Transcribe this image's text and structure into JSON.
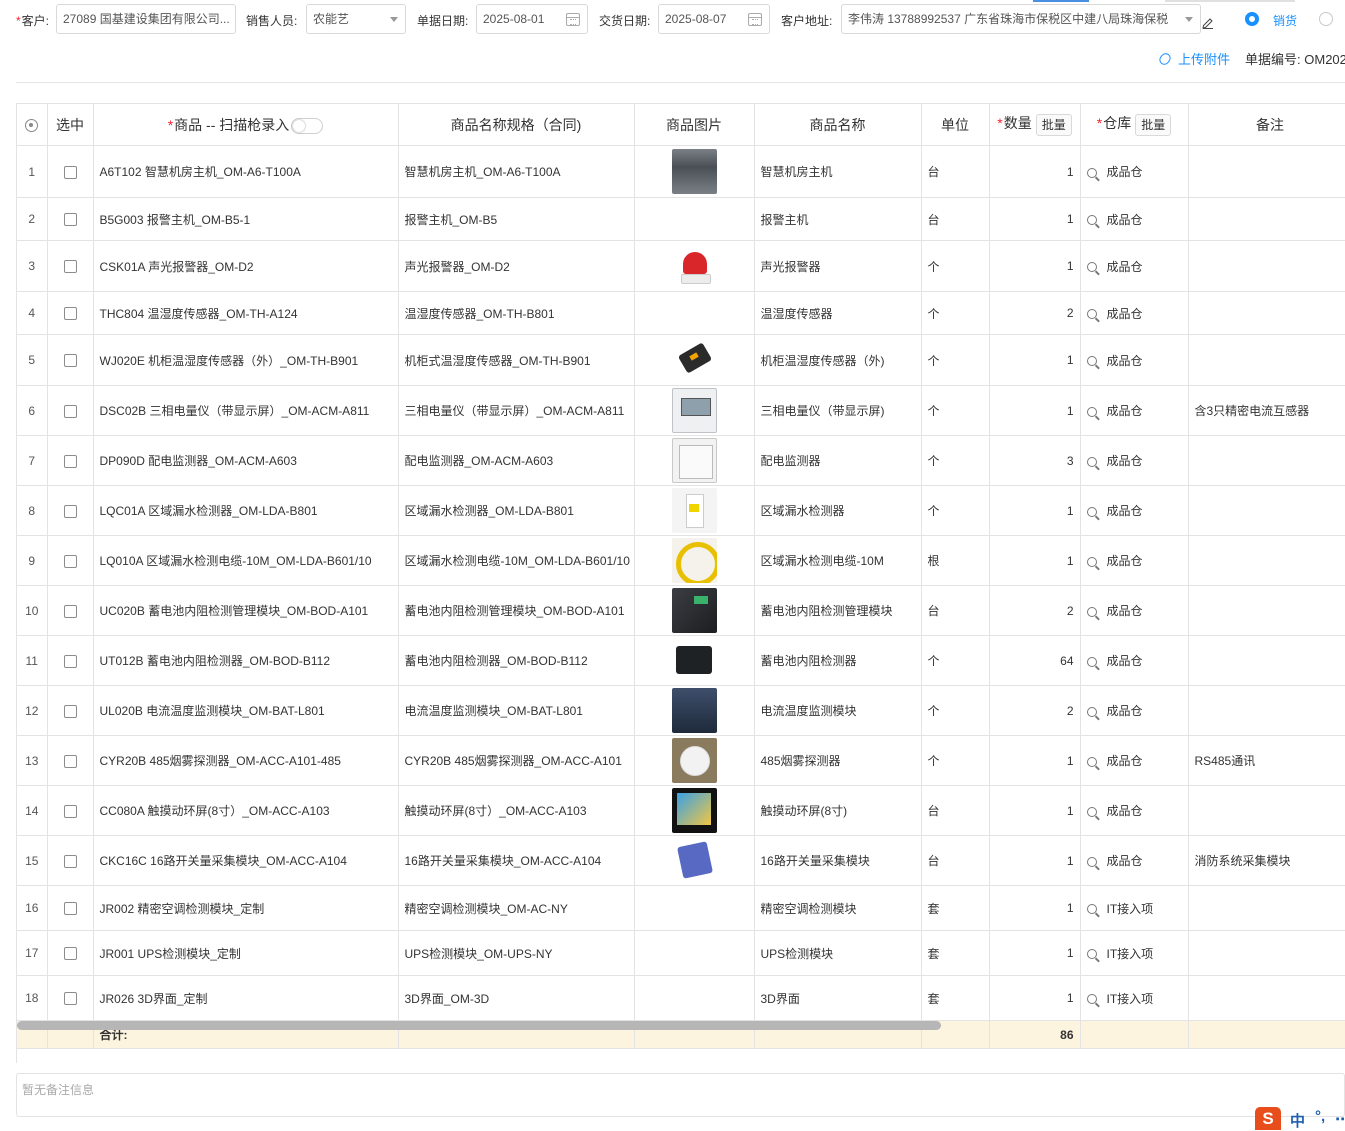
{
  "form": {
    "customer_label": "客户:",
    "customer_value": "27089 国基建设集团有限公司...",
    "sales_label": "销售人员:",
    "sales_value": "农能艺",
    "order_date_label": "单据日期:",
    "order_date_value": "2025-08-01",
    "delivery_date_label": "交货日期:",
    "delivery_date_value": "2025-08-07",
    "address_label": "客户地址:",
    "address_value": "李伟涛 13788992537   广东省珠海市保税区中建八局珠海保税",
    "type_option_sale": "销货",
    "upload_label": "上传附件",
    "doc_no_label": "单据编号:",
    "doc_no_value": "OM202"
  },
  "table": {
    "headers": {
      "select": "选中",
      "product": "商品 -- 扫描枪录入",
      "spec": "商品名称规格（合同)",
      "image": "商品图片",
      "name": "商品名称",
      "unit": "单位",
      "qty": "数量",
      "warehouse": "仓库",
      "batch_label": "批量",
      "remarks": "备注"
    },
    "rows": [
      {
        "idx": "1",
        "product": "A6T102 智慧机房主机_OM-A6-T100A",
        "spec": "智慧机房主机_OM-A6-T100A",
        "image": "rack-unit",
        "name": "智慧机房主机",
        "unit": "台",
        "qty": "1",
        "warehouse": "成品仓",
        "remark": ""
      },
      {
        "idx": "2",
        "product": "B5G003 报警主机_OM-B5-1",
        "spec": "报警主机_OM-B5",
        "image": "",
        "name": "报警主机",
        "unit": "台",
        "qty": "1",
        "warehouse": "成品仓",
        "remark": ""
      },
      {
        "idx": "3",
        "product": "CSK01A 声光报警器_OM-D2",
        "spec": "声光报警器_OM-D2",
        "image": "alarm",
        "name": "声光报警器",
        "unit": "个",
        "qty": "1",
        "warehouse": "成品仓",
        "remark": ""
      },
      {
        "idx": "4",
        "product": "THC804 温湿度传感器_OM-TH-A124",
        "spec": "温湿度传感器_OM-TH-B801",
        "image": "",
        "name": "温湿度传感器",
        "unit": "个",
        "qty": "2",
        "warehouse": "成品仓",
        "remark": ""
      },
      {
        "idx": "5",
        "product": "WJ020E 机柜温湿度传感器（外）_OM-TH-B901",
        "spec": "机柜式温湿度传感器_OM-TH-B901",
        "image": "sensor",
        "name": "机柜温湿度传感器（外)",
        "unit": "个",
        "qty": "1",
        "warehouse": "成品仓",
        "remark": ""
      },
      {
        "idx": "6",
        "product": "DSC02B 三相电量仪（带显示屏）_OM-ACM-A811",
        "spec": "三相电量仪（带显示屏）_OM-ACM-A811",
        "image": "meter",
        "name": "三相电量仪（带显示屏)",
        "unit": "个",
        "qty": "1",
        "warehouse": "成品仓",
        "remark": "含3只精密电流互感器"
      },
      {
        "idx": "7",
        "product": "DP090D 配电监测器_OM-ACM-A603",
        "spec": "配电监测器_OM-ACM-A603",
        "image": "din",
        "name": "配电监测器",
        "unit": "个",
        "qty": "3",
        "warehouse": "成品仓",
        "remark": ""
      },
      {
        "idx": "8",
        "product": "LQC01A 区域漏水检测器_OM-LDA-B801",
        "spec": "区域漏水检测器_OM-LDA-B801",
        "image": "leak",
        "name": "区域漏水检测器",
        "unit": "个",
        "qty": "1",
        "warehouse": "成品仓",
        "remark": ""
      },
      {
        "idx": "9",
        "product": "LQ010A 区域漏水检测电缆-10M_OM-LDA-B601/10",
        "spec": "区域漏水检测电缆-10M_OM-LDA-B601/10",
        "image": "cable",
        "name": "区域漏水检测电缆-10M",
        "unit": "根",
        "qty": "1",
        "warehouse": "成品仓",
        "remark": ""
      },
      {
        "idx": "10",
        "product": "UC020B 蓄电池内阻检测管理模块_OM-BOD-A101",
        "spec": "蓄电池内阻检测管理模块_OM-BOD-A101",
        "image": "box",
        "name": "蓄电池内阻检测管理模块",
        "unit": "台",
        "qty": "2",
        "warehouse": "成品仓",
        "remark": ""
      },
      {
        "idx": "11",
        "product": "UT012B 蓄电池内阻检测器_OM-BOD-B112",
        "spec": "蓄电池内阻检测器_OM-BOD-B112",
        "image": "black",
        "name": "蓄电池内阻检测器",
        "unit": "个",
        "qty": "64",
        "warehouse": "成品仓",
        "remark": ""
      },
      {
        "idx": "12",
        "product": "UL020B 电流温度监测模块_OM-BAT-L801",
        "spec": "电流温度监测模块_OM-BAT-L801",
        "image": "blue",
        "name": "电流温度监测模块",
        "unit": "个",
        "qty": "2",
        "warehouse": "成品仓",
        "remark": ""
      },
      {
        "idx": "13",
        "product": "CYR20B 485烟雾探测器_OM-ACC-A101-485",
        "spec": "CYR20B 485烟雾探测器_OM-ACC-A101",
        "image": "smoke",
        "name": "485烟雾探测器",
        "unit": "个",
        "qty": "1",
        "warehouse": "成品仓",
        "remark": "RS485通讯"
      },
      {
        "idx": "14",
        "product": "CC080A 触摸动环屏(8寸）_OM-ACC-A103",
        "spec": "触摸动环屏(8寸）_OM-ACC-A103",
        "image": "screen",
        "name": "触摸动环屏(8寸)",
        "unit": "台",
        "qty": "1",
        "warehouse": "成品仓",
        "remark": ""
      },
      {
        "idx": "15",
        "product": "CKC16C 16路开关量采集模块_OM-ACC-A104",
        "spec": "16路开关量采集模块_OM-ACC-A104",
        "image": "din2",
        "name": "16路开关量采集模块",
        "unit": "台",
        "qty": "1",
        "warehouse": "成品仓",
        "remark": "消防系统采集模块"
      },
      {
        "idx": "16",
        "product": "JR002 精密空调检测模块_定制",
        "spec": "精密空调检测模块_OM-AC-NY",
        "image": "",
        "name": "精密空调检测模块",
        "unit": "套",
        "qty": "1",
        "warehouse": "IT接入项",
        "remark": ""
      },
      {
        "idx": "17",
        "product": "JR001 UPS检测模块_定制",
        "spec": "UPS检测模块_OM-UPS-NY",
        "image": "",
        "name": "UPS检测模块",
        "unit": "套",
        "qty": "1",
        "warehouse": "IT接入项",
        "remark": ""
      },
      {
        "idx": "18",
        "product": "JR026 3D界面_定制",
        "spec": "3D界面_OM-3D",
        "image": "",
        "name": "3D界面",
        "unit": "套",
        "qty": "1",
        "warehouse": "IT接入项",
        "remark": ""
      }
    ],
    "total_label": "合计:",
    "total_qty": "86"
  },
  "remarks_placeholder": "暂无备注信息",
  "ime": {
    "logo": "S",
    "mode": "中",
    "punct": "°,",
    "more": "⋯"
  }
}
